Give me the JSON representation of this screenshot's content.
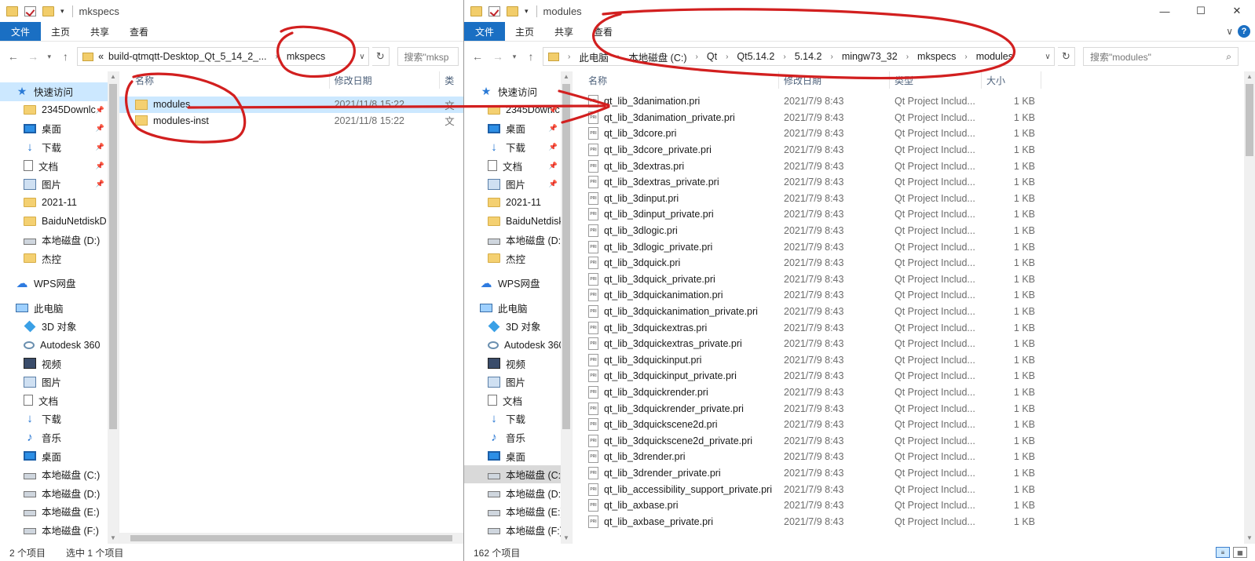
{
  "left": {
    "title": "mkspecs",
    "ribbon": {
      "file": "文件",
      "home": "主页",
      "share": "共享",
      "view": "查看"
    },
    "path": [
      "«",
      "build-qtmqtt-Desktop_Qt_5_14_2_...",
      "mkspecs"
    ],
    "search_placeholder": "搜索\"mksp",
    "columns": {
      "name": "名称",
      "date": "修改日期",
      "type": "类"
    },
    "files": [
      {
        "name": "modules",
        "date": "2021/11/8 15:22",
        "type": "文"
      },
      {
        "name": "modules-inst",
        "date": "2021/11/8 15:22",
        "type": "文"
      }
    ],
    "nav": [
      {
        "label": "快速访问",
        "icon": "star-icon",
        "group": true,
        "sel": true
      },
      {
        "label": "2345Downlc",
        "icon": "folder-icon",
        "pin": true
      },
      {
        "label": "桌面",
        "icon": "desktop-icon",
        "pin": true
      },
      {
        "label": "下载",
        "icon": "download-icon",
        "pin": true
      },
      {
        "label": "文档",
        "icon": "document-icon",
        "pin": true
      },
      {
        "label": "图片",
        "icon": "pictures-icon",
        "pin": true
      },
      {
        "label": "2021-11",
        "icon": "folder-icon"
      },
      {
        "label": "BaiduNetdiskD",
        "icon": "folder-icon"
      },
      {
        "label": "本地磁盘 (D:)",
        "icon": "drive-icon"
      },
      {
        "label": "杰控",
        "icon": "folder-icon"
      },
      {
        "label": "",
        "icon": "spacer"
      },
      {
        "label": "WPS网盘",
        "icon": "cloud-icon",
        "group": true
      },
      {
        "label": "",
        "icon": "spacer"
      },
      {
        "label": "此电脑",
        "icon": "computer-icon",
        "group": true
      },
      {
        "label": "3D 对象",
        "icon": "3d-objects-icon"
      },
      {
        "label": "Autodesk 360",
        "icon": "autodesk-icon"
      },
      {
        "label": "视频",
        "icon": "video-icon"
      },
      {
        "label": "图片",
        "icon": "pictures-icon"
      },
      {
        "label": "文档",
        "icon": "document-icon"
      },
      {
        "label": "下载",
        "icon": "download-icon"
      },
      {
        "label": "音乐",
        "icon": "music-icon"
      },
      {
        "label": "桌面",
        "icon": "desktop-icon"
      },
      {
        "label": "本地磁盘 (C:)",
        "icon": "drive-icon"
      },
      {
        "label": "本地磁盘 (D:)",
        "icon": "drive-icon"
      },
      {
        "label": "本地磁盘 (E:)",
        "icon": "drive-icon"
      },
      {
        "label": "本地磁盘 (F:)",
        "icon": "drive-icon"
      }
    ],
    "status_count": "2 个项目",
    "status_selected": "选中 1 个项目"
  },
  "right": {
    "title": "modules",
    "ribbon": {
      "file": "文件",
      "home": "主页",
      "share": "共享",
      "view": "查看"
    },
    "path": [
      "此电脑",
      "本地磁盘 (C:)",
      "Qt",
      "Qt5.14.2",
      "5.14.2",
      "mingw73_32",
      "mkspecs",
      "modules"
    ],
    "search_placeholder": "搜索\"modules\"",
    "columns": {
      "name": "名称",
      "date": "修改日期",
      "type": "类型",
      "size": "大小"
    },
    "files_date": "2021/7/9 8:43",
    "files_type": "Qt Project Includ...",
    "files_size": "1 KB",
    "files": [
      "qt_lib_3danimation.pri",
      "qt_lib_3danimation_private.pri",
      "qt_lib_3dcore.pri",
      "qt_lib_3dcore_private.pri",
      "qt_lib_3dextras.pri",
      "qt_lib_3dextras_private.pri",
      "qt_lib_3dinput.pri",
      "qt_lib_3dinput_private.pri",
      "qt_lib_3dlogic.pri",
      "qt_lib_3dlogic_private.pri",
      "qt_lib_3dquick.pri",
      "qt_lib_3dquick_private.pri",
      "qt_lib_3dquickanimation.pri",
      "qt_lib_3dquickanimation_private.pri",
      "qt_lib_3dquickextras.pri",
      "qt_lib_3dquickextras_private.pri",
      "qt_lib_3dquickinput.pri",
      "qt_lib_3dquickinput_private.pri",
      "qt_lib_3dquickrender.pri",
      "qt_lib_3dquickrender_private.pri",
      "qt_lib_3dquickscene2d.pri",
      "qt_lib_3dquickscene2d_private.pri",
      "qt_lib_3drender.pri",
      "qt_lib_3drender_private.pri",
      "qt_lib_accessibility_support_private.pri",
      "qt_lib_axbase.pri",
      "qt_lib_axbase_private.pri"
    ],
    "nav": [
      {
        "label": "快速访问",
        "icon": "star-icon",
        "group": true
      },
      {
        "label": "2345Downlc",
        "icon": "folder-icon",
        "pin": true
      },
      {
        "label": "桌面",
        "icon": "desktop-icon",
        "pin": true
      },
      {
        "label": "下载",
        "icon": "download-icon",
        "pin": true
      },
      {
        "label": "文档",
        "icon": "document-icon",
        "pin": true
      },
      {
        "label": "图片",
        "icon": "pictures-icon",
        "pin": true
      },
      {
        "label": "2021-11",
        "icon": "folder-icon"
      },
      {
        "label": "BaiduNetdiskD",
        "icon": "folder-icon"
      },
      {
        "label": "本地磁盘 (D:)",
        "icon": "drive-icon"
      },
      {
        "label": "杰控",
        "icon": "folder-icon"
      },
      {
        "label": "",
        "icon": "spacer"
      },
      {
        "label": "WPS网盘",
        "icon": "cloud-icon",
        "group": true
      },
      {
        "label": "",
        "icon": "spacer"
      },
      {
        "label": "此电脑",
        "icon": "computer-icon",
        "group": true
      },
      {
        "label": "3D 对象",
        "icon": "3d-objects-icon"
      },
      {
        "label": "Autodesk 360",
        "icon": "autodesk-icon"
      },
      {
        "label": "视频",
        "icon": "video-icon"
      },
      {
        "label": "图片",
        "icon": "pictures-icon"
      },
      {
        "label": "文档",
        "icon": "document-icon"
      },
      {
        "label": "下载",
        "icon": "download-icon"
      },
      {
        "label": "音乐",
        "icon": "music-icon"
      },
      {
        "label": "桌面",
        "icon": "desktop-icon"
      },
      {
        "label": "本地磁盘 (C:)",
        "icon": "drive-icon",
        "gsel": true
      },
      {
        "label": "本地磁盘 (D:)",
        "icon": "drive-icon"
      },
      {
        "label": "本地磁盘 (E:)",
        "icon": "drive-icon"
      },
      {
        "label": "本地磁盘 (F:)",
        "icon": "drive-icon"
      }
    ],
    "status_count": "162 个项目"
  },
  "colors": {
    "accent": "#1a6fc3",
    "selection": "#cce8ff",
    "annotation": "#d21f1f"
  }
}
